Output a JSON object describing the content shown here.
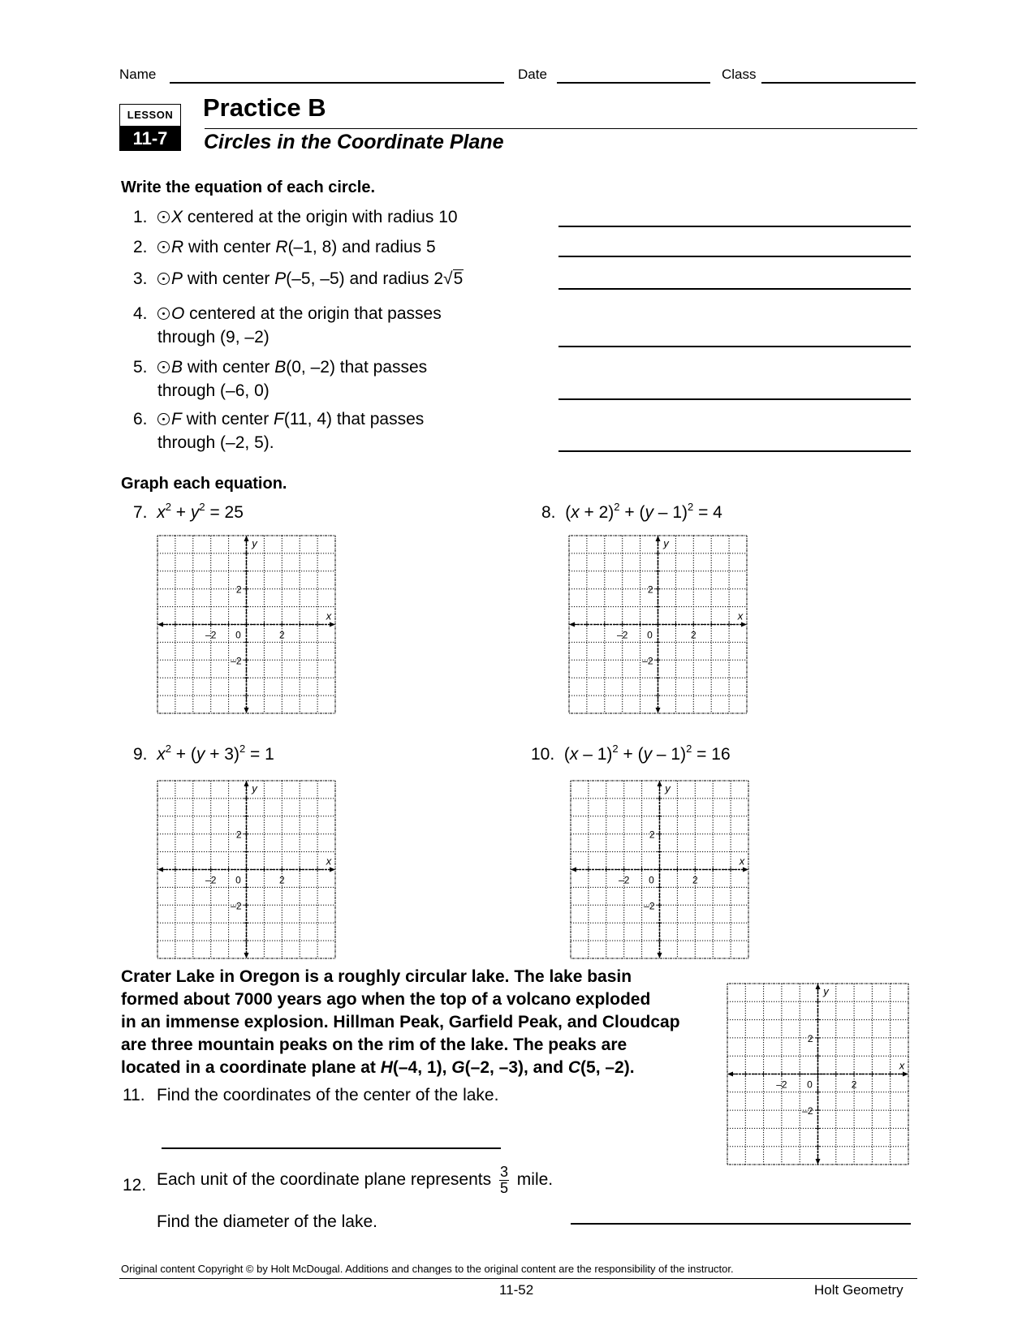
{
  "header": {
    "name_label": "Name",
    "date_label": "Date",
    "class_label": "Class",
    "lesson_label": "LESSON",
    "lesson_number": "11-7",
    "title": "Practice B",
    "subtitle": "Circles in the Coordinate Plane"
  },
  "section1": {
    "heading": "Write the equation of each circle.",
    "items": [
      {
        "num": "1.",
        "circle": "X",
        "pre": "",
        "text": " centered at the origin with radius 10",
        "line2": ""
      },
      {
        "num": "2.",
        "circle": "R",
        "text_a": " with center ",
        "center_name": "R",
        "text_b": "(–1, 8) and radius 5"
      },
      {
        "num": "3.",
        "circle": "P",
        "text_a": " with center ",
        "center_name": "P",
        "text_b": "(–5, –5) and radius ",
        "radius_coef": "2",
        "radius_root": "5"
      },
      {
        "num": "4.",
        "circle": "O",
        "text": " centered at the origin that passes",
        "line2": "through (9, –2)"
      },
      {
        "num": "5.",
        "circle": "B",
        "text_a": " with center ",
        "center_name": "B",
        "text_b": "(0, –2) that passes",
        "line2": "through (–6, 0)"
      },
      {
        "num": "6.",
        "circle": "F",
        "text_a": " with center ",
        "center_name": "F",
        "text_b": "(11, 4) that passes",
        "line2": "through (–2, 5)."
      }
    ]
  },
  "section2": {
    "heading": "Graph each equation.",
    "problems": [
      {
        "num": "7.",
        "eq": "x² + y² = 25"
      },
      {
        "num": "8.",
        "eq": "(x + 2)² + (y – 1)² = 4"
      },
      {
        "num": "9.",
        "eq": "x² + (y + 3)² = 1"
      },
      {
        "num": "10.",
        "eq": "(x – 1)² + (y – 1)² = 16"
      }
    ],
    "grid": {
      "x_range": [
        -5,
        5
      ],
      "y_range": [
        -5,
        5
      ],
      "tick_labels": {
        "x_neg": "–2",
        "origin": "0",
        "x_pos": "2",
        "y_pos": "2",
        "y_neg": "–2"
      },
      "x_axis_label": "x",
      "y_axis_label": "y"
    }
  },
  "crater": {
    "paragraph_1": "Crater Lake in Oregon is a roughly circular lake. The lake basin",
    "paragraph_2": "formed about 7000 years ago when the top of a volcano exploded",
    "paragraph_3": "in an immense explosion. Hillman Peak, Garfield Peak, and Cloudcap",
    "paragraph_4": "are three mountain peaks on the rim of the lake. The peaks are",
    "paragraph_5a": "located in a coordinate plane at ",
    "peak_h": "H",
    "peak_h_coord": "(–4, 1), ",
    "peak_g": "G",
    "peak_g_coord": "(–2, –3), and ",
    "peak_c": "C",
    "peak_c_coord": "(5, –2).",
    "q11_num": "11.",
    "q11_text": "Find the coordinates of the center of the lake.",
    "q12_num": "12.",
    "q12_text_a": "Each unit of the coordinate plane represents",
    "q12_frac_num": "3",
    "q12_frac_den": "5",
    "q12_text_b": "mile.",
    "q12_text_c": "Find the diameter of the lake."
  },
  "footer": {
    "copyright": "Original content Copyright © by Holt McDougal. Additions and changes to the original content are the responsibility of the instructor.",
    "page": "11-52",
    "book": "Holt Geometry"
  }
}
